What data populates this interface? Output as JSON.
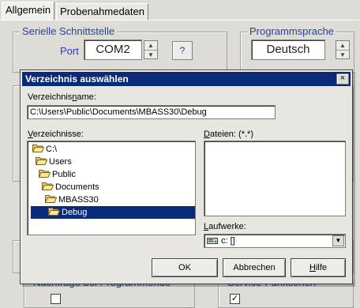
{
  "tabs": [
    {
      "label": "Allgemein"
    },
    {
      "label": "Probenahmedaten"
    }
  ],
  "serial": {
    "title": "Serielle Schnittstelle",
    "port_label": "Port",
    "port_value": "COM2",
    "help_label": "?"
  },
  "language": {
    "title": "Programmsprache",
    "value": "Deutsch"
  },
  "bottom_groups": {
    "left_title": "Nachfrage bei Programmende",
    "right_title": "Service-Funktionen",
    "right_checkbox": "✓"
  },
  "dialog": {
    "title": "Verzeichnis auswählen",
    "close_label": "×",
    "dirname_label_pre": "Verzeichnis",
    "dirname_label_u": "n",
    "dirname_label_post": "ame:",
    "dirname_value": "C:\\Users\\Public\\Documents\\MBASS30\\Debug",
    "dirs_label_u": "V",
    "dirs_label_post": "erzeichnisse:",
    "files_label_u": "D",
    "files_label_post": "ateien: (*.*)",
    "tree": [
      {
        "label": "C:\\",
        "selected": false
      },
      {
        "label": "Users",
        "selected": false
      },
      {
        "label": "Public",
        "selected": false
      },
      {
        "label": "Documents",
        "selected": false
      },
      {
        "label": "MBASS30",
        "selected": false
      },
      {
        "label": "Debug",
        "selected": true
      }
    ],
    "drives_label_u": "L",
    "drives_label_post": "aufwerke:",
    "drive_value": "c: []",
    "ok_label": "OK",
    "cancel_label": "Abbrechen",
    "help_label_u": "H",
    "help_label_post": "ilfe"
  },
  "colors": {
    "titlebar": "#0a2a7a",
    "group_title": "#2a3fa8",
    "folder": "#f0d060"
  }
}
